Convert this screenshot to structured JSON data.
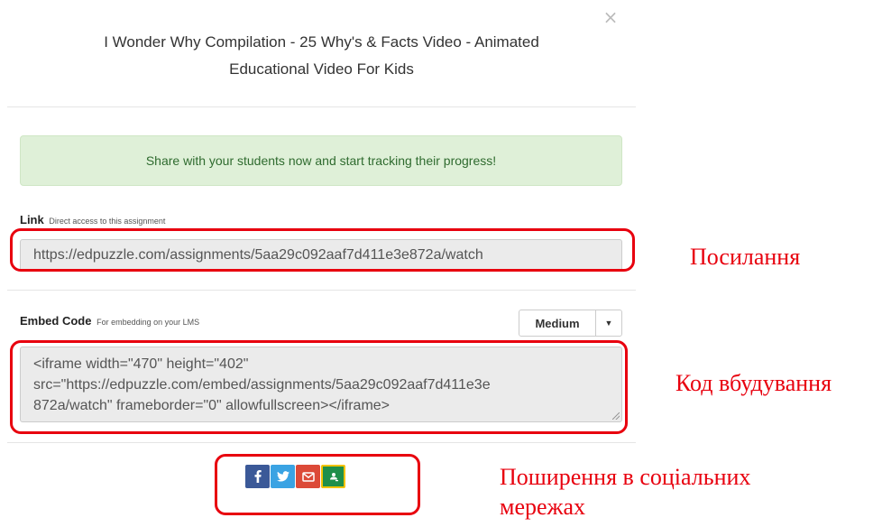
{
  "modal": {
    "close_glyph": "×",
    "title_line1": "I Wonder Why Compilation - 25 Why's & Facts Video - Animated",
    "title_line2": "Educational Video For Kids",
    "alert_text": "Share with your students now and start tracking their progress!",
    "link": {
      "label": "Link",
      "sublabel": "Direct access to this assignment",
      "value": "https://edpuzzle.com/assignments/5aa29c092aaf7d411e3e872a/watch"
    },
    "embed": {
      "label": "Embed Code",
      "sublabel": "For embedding on your LMS",
      "size_option": "Medium",
      "code_line1": "<iframe width=\"470\" height=\"402\"",
      "code_line2": "src=\"https://edpuzzle.com/embed/assignments/5aa29c092aaf7d411e3e",
      "code_line3": "872a/watch\" frameborder=\"0\" allowfullscreen></iframe>"
    },
    "share_buttons": [
      {
        "name": "facebook",
        "icon": "facebook-icon",
        "color": "#3b5998"
      },
      {
        "name": "twitter",
        "icon": "twitter-icon",
        "color": "#3aa3e3"
      },
      {
        "name": "email",
        "icon": "mail-icon",
        "color": "#dc4a38"
      },
      {
        "name": "google-classroom",
        "icon": "google-classroom-icon",
        "color": "#1f8f4a"
      }
    ]
  },
  "annotations": {
    "color": "#e8000e",
    "link_label": "Посилання",
    "embed_label": "Код вбудування",
    "share_label_line1": "Поширення в соціальних",
    "share_label_line2": "мережах"
  }
}
